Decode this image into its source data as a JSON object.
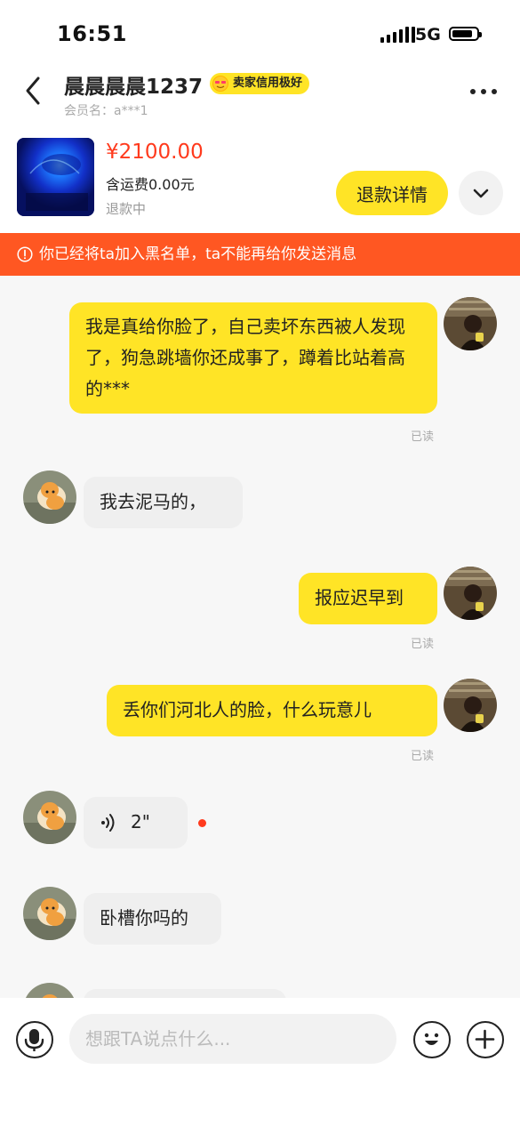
{
  "status_bar": {
    "time": "16:51",
    "network": "5G"
  },
  "header": {
    "seller_name": "晨晨晨晨1237",
    "credit_badge": "卖家信用极好",
    "member_id": "会员名：a***1"
  },
  "order": {
    "price": "¥2100.00",
    "shipping": "含运费0.00元",
    "status": "退款中",
    "refund_button": "退款详情"
  },
  "banner": {
    "text": "你已经将ta加入黑名单，ta不能再给你发送消息"
  },
  "messages": [
    {
      "side": "me",
      "text": "我是真给你脸了，自己卖坏东西被人发现了，狗急跳墙你还成事了，蹲着比站着高的***",
      "read": "已读"
    },
    {
      "side": "them",
      "text": "我去泥马的，"
    },
    {
      "side": "me",
      "text": "报应迟早到",
      "read": "已读"
    },
    {
      "side": "me",
      "text": "丢你们河北人的脸，什么玩意儿",
      "read": "已读"
    },
    {
      "side": "them",
      "type": "voice",
      "duration": "2\""
    },
    {
      "side": "them",
      "text": "卧槽你吗的"
    }
  ],
  "input": {
    "placeholder": "想跟TA说点什么..."
  },
  "colors": {
    "accent_yellow": "#ffe426",
    "price_red": "#ff3a1d",
    "banner_orange": "#ff5722"
  }
}
